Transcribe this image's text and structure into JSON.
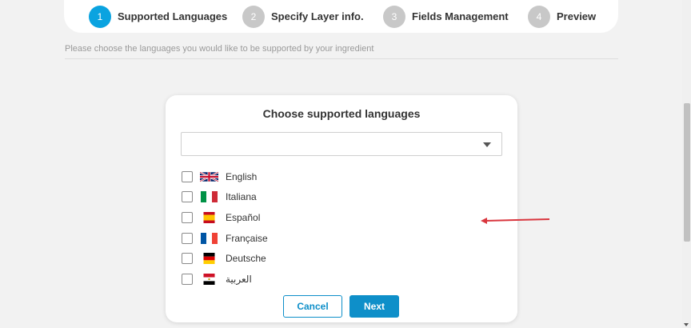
{
  "stepper": {
    "steps": [
      {
        "num": "1",
        "label": "Supported Languages",
        "active": true
      },
      {
        "num": "2",
        "label": "Specify Layer info.",
        "active": false
      },
      {
        "num": "3",
        "label": "Fields Management",
        "active": false
      },
      {
        "num": "4",
        "label": "Preview",
        "active": false
      }
    ]
  },
  "instruction": "Please choose the languages you would like to be supported by your ingredient",
  "modal": {
    "title": "Choose supported languages",
    "select_value": "",
    "languages": [
      {
        "label": "English",
        "flag": "uk-flag-icon",
        "checked": false
      },
      {
        "label": "Italiana",
        "flag": "italy-flag-icon",
        "checked": false
      },
      {
        "label": "Español",
        "flag": "spain-flag-icon",
        "checked": false
      },
      {
        "label": "Française",
        "flag": "france-flag-icon",
        "checked": false
      },
      {
        "label": "Deutsche",
        "flag": "germany-flag-icon",
        "checked": false
      },
      {
        "label": "العربية",
        "flag": "egypt-flag-icon",
        "checked": false
      }
    ],
    "cancel_label": "Cancel",
    "next_label": "Next"
  },
  "colors": {
    "accent": "#0e8fc9",
    "step_active": "#0aa3e0",
    "step_inactive": "#c8c8c8",
    "annotation_arrow": "#d9363e"
  }
}
